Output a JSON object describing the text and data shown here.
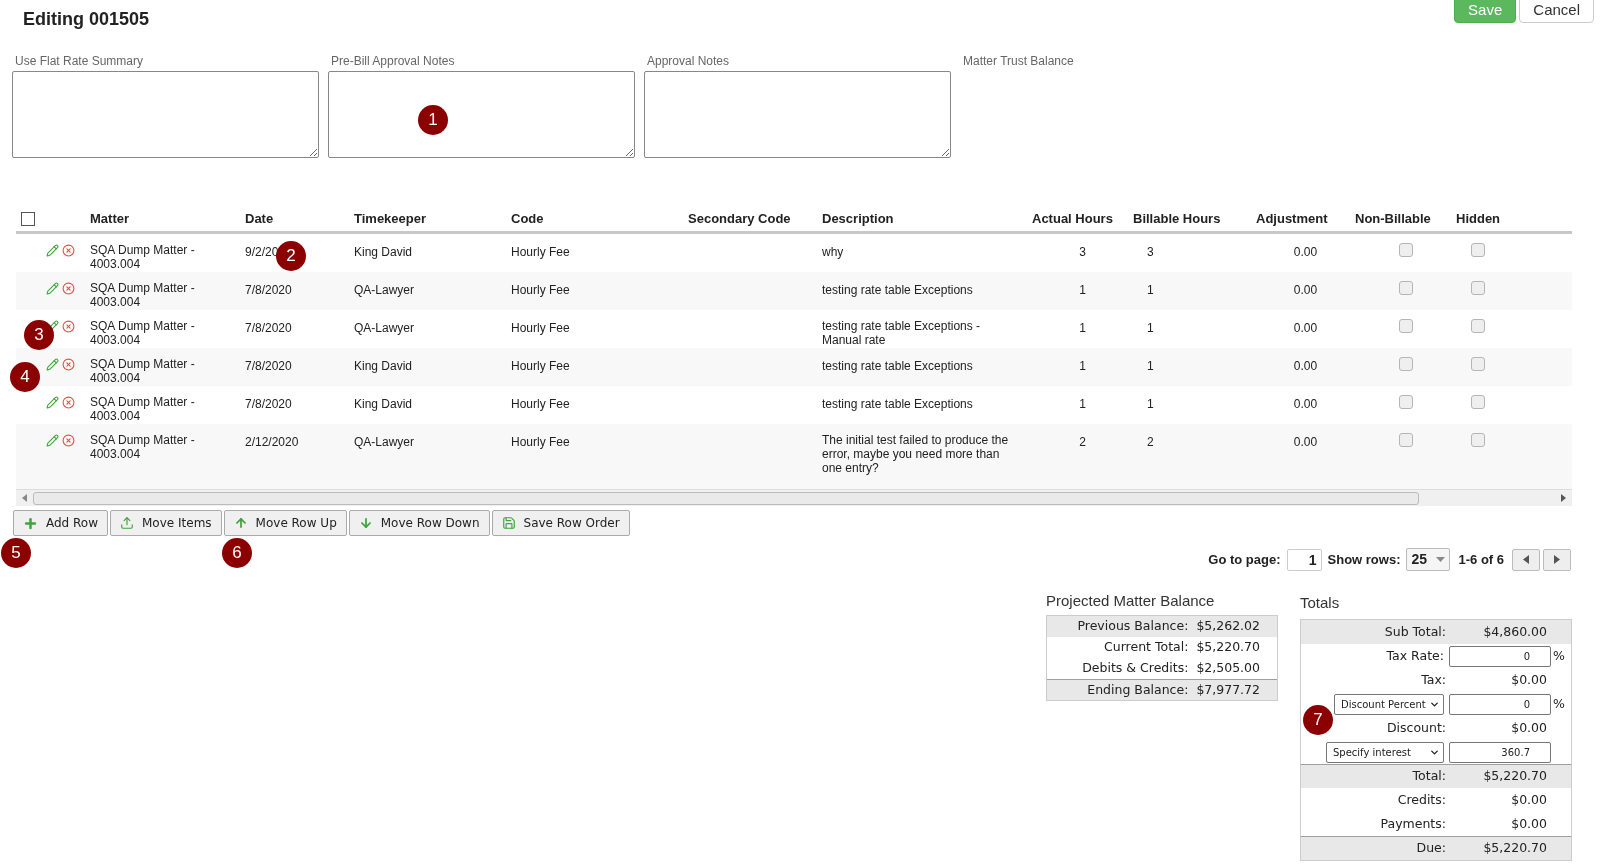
{
  "title": "Editing 001505",
  "actions": [
    {
      "label": "Save",
      "kind": "primary"
    },
    {
      "label": "Cancel",
      "kind": "default"
    }
  ],
  "notes": [
    {
      "label": "Use Flat Rate Summary",
      "kind": "textarea"
    },
    {
      "label": "Pre-Bill Approval Notes",
      "kind": "textarea"
    },
    {
      "label": "Approval Notes",
      "kind": "textarea"
    },
    {
      "label": "Matter Trust Balance",
      "kind": "label"
    }
  ],
  "table": {
    "select_all": {
      "checked": false
    },
    "columns": [
      "Matter",
      "Date",
      "Timekeeper",
      "Code",
      "Secondary Code",
      "Description",
      "Actual Hours",
      "Billable Hours",
      "Adjustment",
      "Non-Billable",
      "Hidden"
    ],
    "rows": [
      {
        "matter": "SQA Dump Matter - 4003.004",
        "date": "9/2/20",
        "timekeeper": "King David",
        "code": "Hourly Fee",
        "description": "why",
        "actual": "3",
        "billable": "3",
        "adjustment": "0.00",
        "non_billable": false,
        "hidden": false
      },
      {
        "matter": "SQA Dump Matter - 4003.004",
        "date": "7/8/2020",
        "timekeeper": "QA-Lawyer",
        "code": "Hourly Fee",
        "description": "testing rate table Exceptions",
        "actual": "1",
        "billable": "1",
        "adjustment": "0.00",
        "non_billable": false,
        "hidden": false
      },
      {
        "matter": "SQA Dump Matter - 4003.004",
        "date": "7/8/2020",
        "timekeeper": "QA-Lawyer",
        "code": "Hourly Fee",
        "description": "testing rate table Exceptions - Manual rate",
        "actual": "1",
        "billable": "1",
        "adjustment": "0.00",
        "non_billable": false,
        "hidden": false
      },
      {
        "matter": "SQA Dump Matter - 4003.004",
        "date": "7/8/2020",
        "timekeeper": "King David",
        "code": "Hourly Fee",
        "description": "testing rate table Exceptions",
        "actual": "1",
        "billable": "1",
        "adjustment": "0.00",
        "non_billable": false,
        "hidden": false
      },
      {
        "matter": "SQA Dump Matter - 4003.004",
        "date": "7/8/2020",
        "timekeeper": "King David",
        "code": "Hourly Fee",
        "description": "testing rate table Exceptions",
        "actual": "1",
        "billable": "1",
        "adjustment": "0.00",
        "non_billable": false,
        "hidden": false
      },
      {
        "matter": "SQA Dump Matter - 4003.004",
        "date": "2/12/2020",
        "timekeeper": "QA-Lawyer",
        "code": "Hourly Fee",
        "description": "The initial test failed to produce the error, maybe you need more than one entry?",
        "actual": "2",
        "billable": "2",
        "adjustment": "0.00",
        "non_billable": false,
        "hidden": false
      }
    ]
  },
  "row_buttons": [
    {
      "label": "Add Row",
      "kind": "add"
    },
    {
      "label": "Move Items",
      "kind": "move"
    },
    {
      "label": "Move Row Up",
      "kind": "up"
    },
    {
      "label": "Move Row Down",
      "kind": "down"
    },
    {
      "label": "Save Row Order",
      "kind": "save"
    }
  ],
  "pager": {
    "goto_label": "Go to page:",
    "page": "1",
    "rows_label": "Show rows:",
    "rows": "25",
    "range": "1-6 of 6"
  },
  "projected": {
    "title": "Projected Matter Balance",
    "rows": [
      {
        "label": "Previous Balance:",
        "value": "$5,262.02",
        "shaded": true,
        "rule": false
      },
      {
        "label": "Current Total:",
        "value": "$5,220.70",
        "shaded": false,
        "rule": false
      },
      {
        "label": "Debits & Credits:",
        "value": "$2,505.00",
        "shaded": false,
        "rule": false
      },
      {
        "label": "Ending Balance:",
        "value": "$7,977.72",
        "shaded": true,
        "rule": true
      }
    ]
  },
  "totals": {
    "title": "Totals",
    "rows": [
      {
        "kind": "value",
        "label": "Sub Total:",
        "value": "$4,860.00",
        "shaded": true,
        "rule": false
      },
      {
        "kind": "input",
        "label": "Tax Rate:",
        "value": "0",
        "unit": "%",
        "shaded": false,
        "rule": false
      },
      {
        "kind": "value",
        "label": "Tax:",
        "value": "$0.00",
        "shaded": false,
        "rule": false
      },
      {
        "kind": "select",
        "label": "Discount Percent",
        "value": "0",
        "unit": "%",
        "shaded": false,
        "rule": false
      },
      {
        "kind": "value",
        "label": "Discount:",
        "value": "$0.00",
        "shaded": false,
        "rule": false
      },
      {
        "kind": "select",
        "label": "Specify interest",
        "value": "360.7",
        "shaded": false,
        "rule": false
      },
      {
        "kind": "value",
        "label": "Total:",
        "value": "$5,220.70",
        "shaded": true,
        "rule": true
      },
      {
        "kind": "value",
        "label": "Credits:",
        "value": "$0.00",
        "shaded": false,
        "rule": false
      },
      {
        "kind": "value",
        "label": "Payments:",
        "value": "$0.00",
        "shaded": false,
        "rule": false
      },
      {
        "kind": "value",
        "label": "Due:",
        "value": "$5,220.70",
        "shaded": true,
        "rule": true
      }
    ]
  },
  "markers": [
    "1",
    "2",
    "3",
    "4",
    "5",
    "6",
    "7"
  ]
}
